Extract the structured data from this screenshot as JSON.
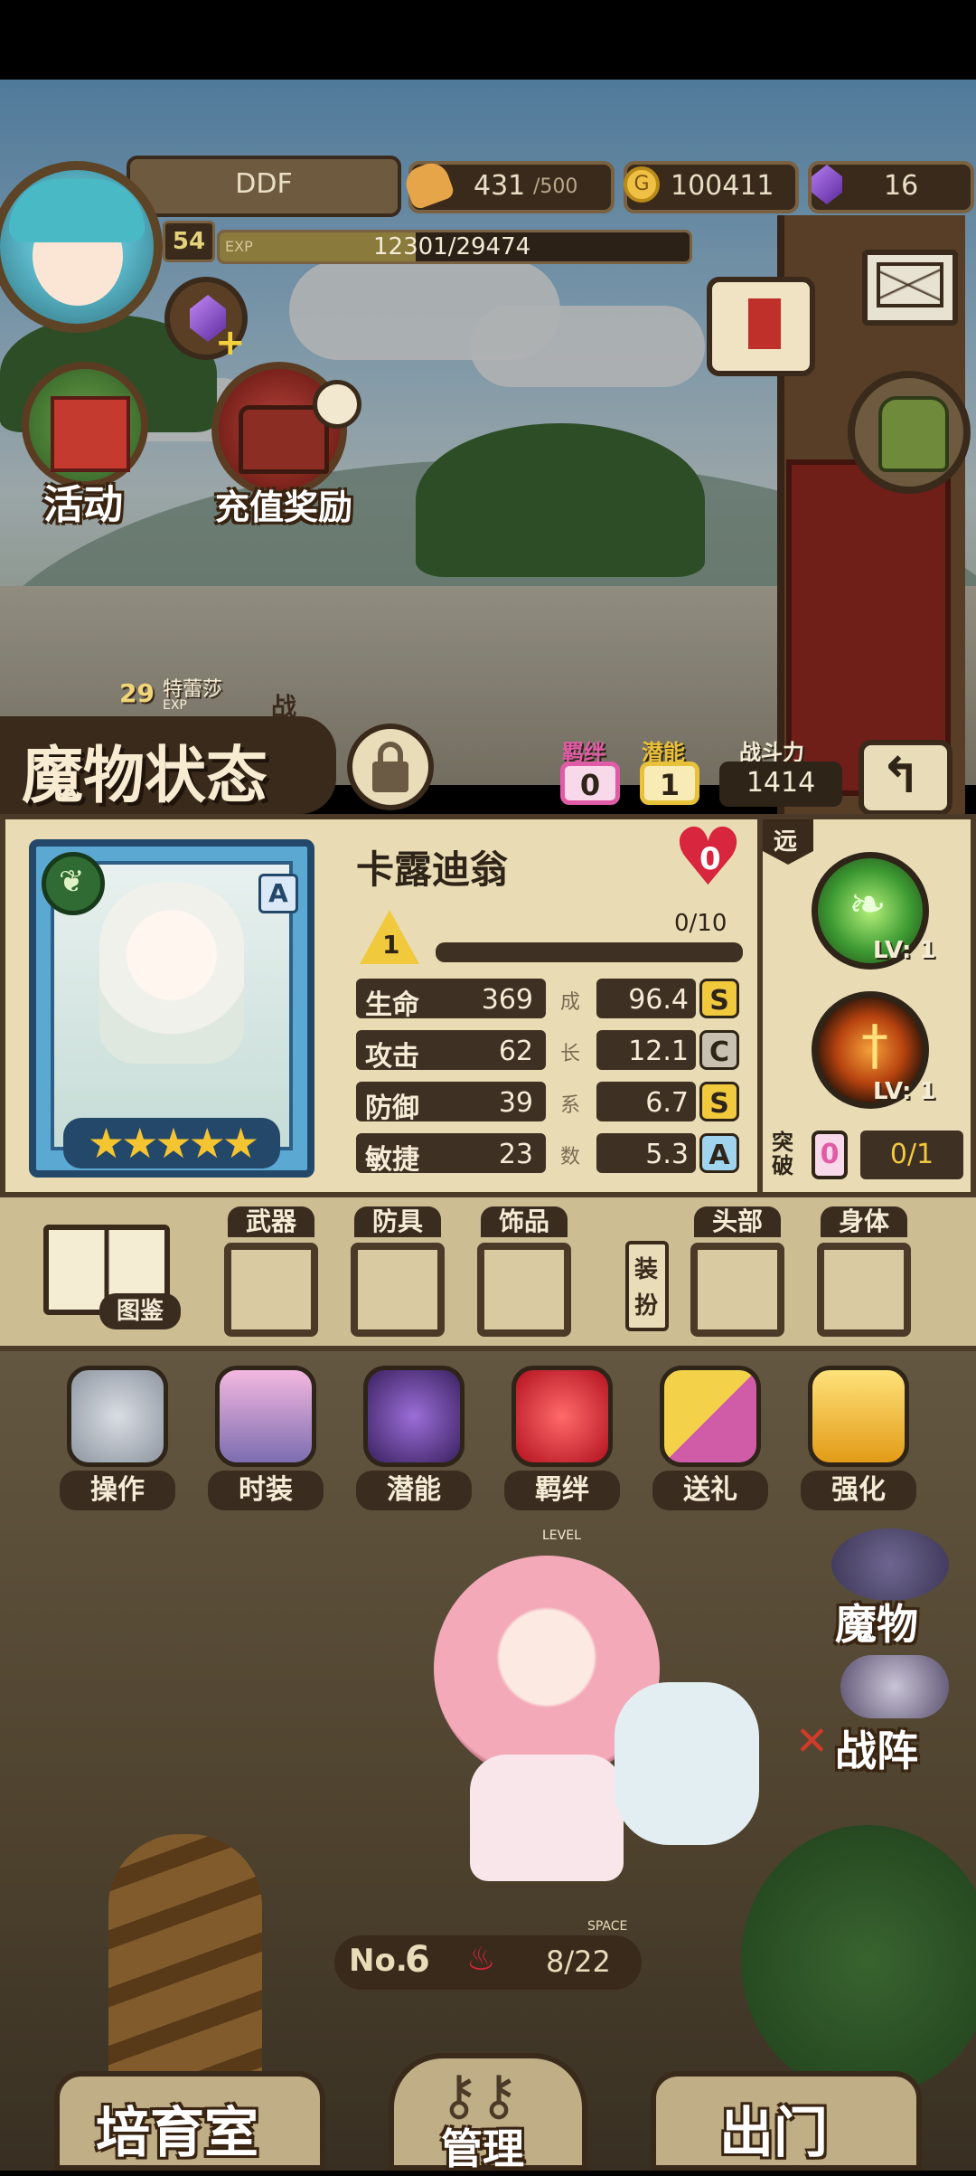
{
  "player": {
    "name": "DDF",
    "level": "54",
    "exp_label": "EXP",
    "exp_text": "12301/29474",
    "exp_progress": 0.4176
  },
  "resources": {
    "stamina_current": "431",
    "stamina_max": "/500",
    "gold": "100411",
    "gems": "16"
  },
  "left_buttons": {
    "activity": "活动",
    "recharge": "充值奖励"
  },
  "field": {
    "monster_level": "29",
    "monster_name": "特蕾莎",
    "exp_label": "EXP",
    "battle_char": "战"
  },
  "status_panel": {
    "title": "魔物状态",
    "bond_label": "羁绊",
    "bond_value": "0",
    "potential_label": "潜能",
    "potential_value": "1",
    "power_label": "战斗力",
    "power_value": "1414",
    "monster_display_name": "卡露迪翁",
    "heart_value": "0",
    "rank_letter": "A",
    "stars": 5,
    "plus_level": "1",
    "plus_progress_text": "0/10",
    "plus_progress": 0,
    "range_label": "远",
    "skills": [
      {
        "level_text": "LV: 1",
        "icon": "wind-leaf-icon"
      },
      {
        "level_text": "LV: 1",
        "icon": "fire-sword-icon"
      }
    ],
    "stats": [
      {
        "label": "生命",
        "value": "369",
        "growth": "96.4",
        "grade": "S"
      },
      {
        "label": "攻击",
        "value": "62",
        "growth": "12.1",
        "grade": "C"
      },
      {
        "label": "防御",
        "value": "39",
        "growth": "6.7",
        "grade": "S"
      },
      {
        "label": "敏捷",
        "value": "23",
        "growth": "5.3",
        "grade": "A"
      }
    ],
    "growth_vertical": [
      "成",
      "长",
      "系",
      "数"
    ],
    "breakthrough_label": "突破",
    "breakthrough_value": "0",
    "breakthrough_progress": "0/1"
  },
  "equipment": {
    "codex_label": "图鉴",
    "slots": [
      "武器",
      "防具",
      "饰品",
      "头部",
      "身体"
    ],
    "dress_label": "装扮"
  },
  "actions": [
    "操作",
    "时装",
    "潜能",
    "羁绊",
    "送礼",
    "强化"
  ],
  "right_menu": {
    "monster": "魔物",
    "formation": "战阵"
  },
  "bottom": {
    "number_prefix": "No.",
    "number": "6",
    "space_label": "SPACE",
    "space_value": "8/22",
    "level_tag": "LEVEL",
    "nav": [
      "培育室",
      "管理",
      "出门"
    ]
  },
  "colors": {
    "panel_bg": "#e9dcb5",
    "panel_border": "#4a3a27",
    "bond_pink": "#e05ca6",
    "potential_yellow": "#e8c13a",
    "grade_S": "#f1c93d",
    "grade_C": "#c8c0b0",
    "grade_A": "#9fd3ee",
    "heart_red": "#d7263d"
  }
}
